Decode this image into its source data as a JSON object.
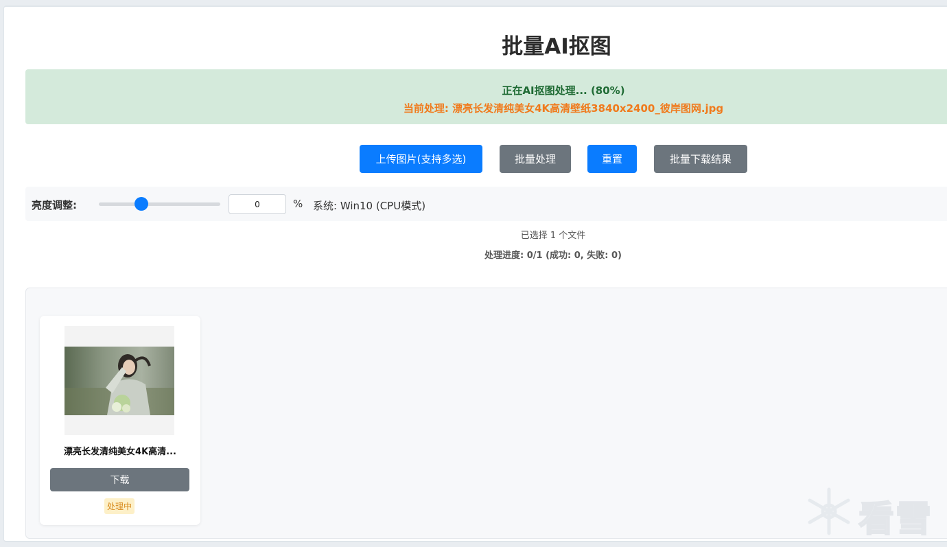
{
  "page": {
    "title": "批量AI抠图"
  },
  "status": {
    "processing_text": "正在AI抠图处理... (80%)",
    "processing_percent": 80,
    "current_file_text": "当前处理: 漂亮长发清纯美女4K高清壁纸3840x2400_彼岸图网.jpg"
  },
  "toolbar": {
    "upload_label": "上传图片(支持多选)",
    "batch_process_label": "批量处理",
    "reset_label": "重置",
    "batch_download_label": "批量下载结果"
  },
  "controls": {
    "brightness_label": "亮度调整:",
    "brightness_value": "0",
    "brightness_slider_fraction": 0.35,
    "percent_sign": "%",
    "system_info": "系统: Win10 (CPU模式)"
  },
  "summary": {
    "selected_files": "已选择 1 个文件",
    "progress": "处理进度: 0/1 (成功: 0, 失败: 0)"
  },
  "results": [
    {
      "file_name": "漂亮长发清纯美女4K高清...",
      "download_label": "下载",
      "status_label": "处理中"
    }
  ],
  "watermark": {
    "text": "看雪"
  },
  "colors": {
    "primary": "#0a7cff",
    "secondary": "#6c757d",
    "success_bg": "#d4eadb",
    "success_text": "#1f6b34",
    "warning_text": "#f07a1c",
    "badge_bg": "#fdf0c8",
    "badge_text": "#d78a1c"
  }
}
